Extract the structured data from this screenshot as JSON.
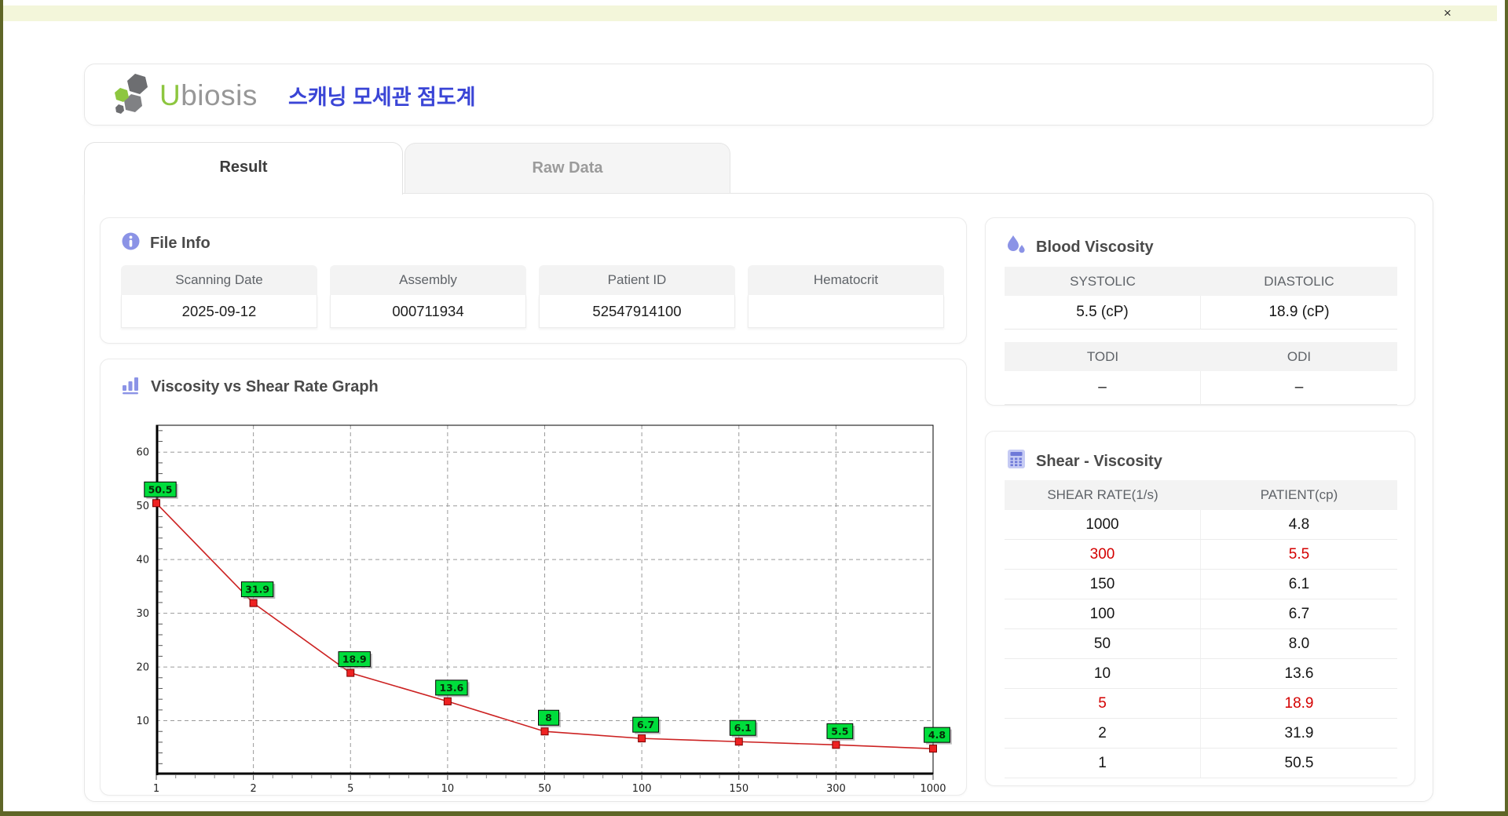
{
  "window": {
    "close_label": "×"
  },
  "header": {
    "logo_u": "U",
    "logo_rest": "biosis",
    "app_title_korean": "스캐닝 모세관 점도계"
  },
  "tabs": [
    {
      "label": "Result",
      "active": true
    },
    {
      "label": "Raw Data",
      "active": false
    }
  ],
  "file_info": {
    "title": "File Info",
    "fields": [
      {
        "label": "Scanning Date",
        "value": "2025-09-12"
      },
      {
        "label": "Assembly",
        "value": "000711934"
      },
      {
        "label": "Patient ID",
        "value": "52547914100"
      },
      {
        "label": "Hematocrit",
        "value": ""
      }
    ]
  },
  "blood_viscosity": {
    "title": "Blood Viscosity",
    "tables": [
      {
        "headers": [
          "SYSTOLIC",
          "DIASTOLIC"
        ],
        "values": [
          "5.5 (cP)",
          "18.9 (cP)"
        ]
      },
      {
        "headers": [
          "TODI",
          "ODI"
        ],
        "values": [
          "–",
          "–"
        ]
      }
    ]
  },
  "shear_viscosity": {
    "title": "Shear - Viscosity",
    "columns": [
      "SHEAR RATE(1/s)",
      "PATIENT(cp)"
    ],
    "rows": [
      {
        "shear_rate": "1000",
        "patient": "4.8",
        "highlight": false
      },
      {
        "shear_rate": "300",
        "patient": "5.5",
        "highlight": true
      },
      {
        "shear_rate": "150",
        "patient": "6.1",
        "highlight": false
      },
      {
        "shear_rate": "100",
        "patient": "6.7",
        "highlight": false
      },
      {
        "shear_rate": "50",
        "patient": "8.0",
        "highlight": false
      },
      {
        "shear_rate": "10",
        "patient": "13.6",
        "highlight": false
      },
      {
        "shear_rate": "5",
        "patient": "18.9",
        "highlight": true
      },
      {
        "shear_rate": "2",
        "patient": "31.9",
        "highlight": false
      },
      {
        "shear_rate": "1",
        "patient": "50.5",
        "highlight": false
      }
    ]
  },
  "graph": {
    "title": "Viscosity vs Shear Rate Graph"
  },
  "chart_data": {
    "type": "line",
    "title": "Viscosity vs Shear Rate Graph",
    "x": [
      1,
      2,
      5,
      10,
      50,
      100,
      150,
      300,
      1000
    ],
    "y": [
      50.5,
      31.9,
      18.9,
      13.6,
      8,
      6.7,
      6.1,
      5.5,
      4.8
    ],
    "point_labels": [
      "50.5",
      "31.9",
      "18.9",
      "13.6",
      "8",
      "6.7",
      "6.1",
      "5.5",
      "4.8"
    ],
    "x_tick_labels": [
      "1",
      "2",
      "5",
      "10",
      "50",
      "100",
      "150",
      "300",
      "1000"
    ],
    "y_ticks": [
      10,
      20,
      30,
      40,
      50,
      60
    ],
    "ylim": [
      0,
      65
    ],
    "x_scale": "category-even-spacing",
    "grid": true,
    "legend": "none",
    "line_color": "#cc2222",
    "marker_color": "#ee2222",
    "marker_border": "#7a0000",
    "label_bg": "#00dd3c",
    "label_border": "#000000",
    "grid_color": "#9a9a9a"
  },
  "colors": {
    "accent_purple": "#8b93e6",
    "korean_title_blue": "#3a45d6",
    "logo_green": "#8dc63f",
    "highlight_red": "#d40000",
    "titlebar": "#f3f6da",
    "window_border": "#5f6627"
  }
}
